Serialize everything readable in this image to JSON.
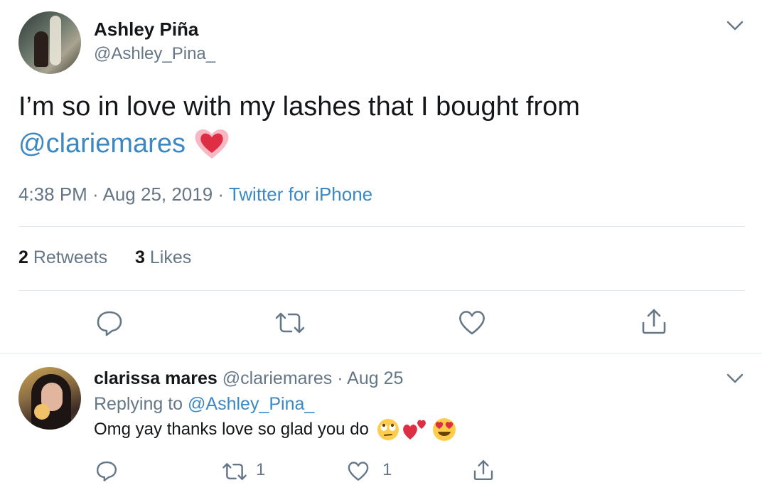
{
  "tweet": {
    "author_name": "Ashley Piña",
    "author_handle": "@Ashley_Pina_",
    "text": "I’m so in love with my lashes that I bought from",
    "mention": "@clariemares",
    "time": "4:38 PM · Aug 25, 2019 · ",
    "source": "Twitter for iPhone",
    "retweets_count": "2",
    "retweets_label": "Retweets",
    "likes_count": "3",
    "likes_label": "Likes"
  },
  "reply": {
    "author_name": "clarissa mares",
    "author_handle": "@clariemares",
    "date": "· Aug 25",
    "replying_prefix": "Replying to ",
    "replying_to": "@Ashley_Pina_",
    "text": "Omg yay thanks love so glad you do",
    "retweet_count": "1",
    "like_count": "1"
  },
  "icons": {
    "menu": "chevron-down-icon",
    "reply": "reply-icon",
    "retweet": "retweet-icon",
    "like": "heart-icon",
    "share": "share-icon",
    "emoji_heart": "sparkling-heart-emoji",
    "emoji_rolling": "face-with-rolling-eyes-emoji",
    "emoji_two_hearts": "two-hearts-emoji",
    "emoji_heart_eyes": "heart-eyes-emoji"
  },
  "colors": {
    "link": "#3b88c3",
    "secondary_text": "#657786",
    "divider": "#e1e8ed"
  }
}
